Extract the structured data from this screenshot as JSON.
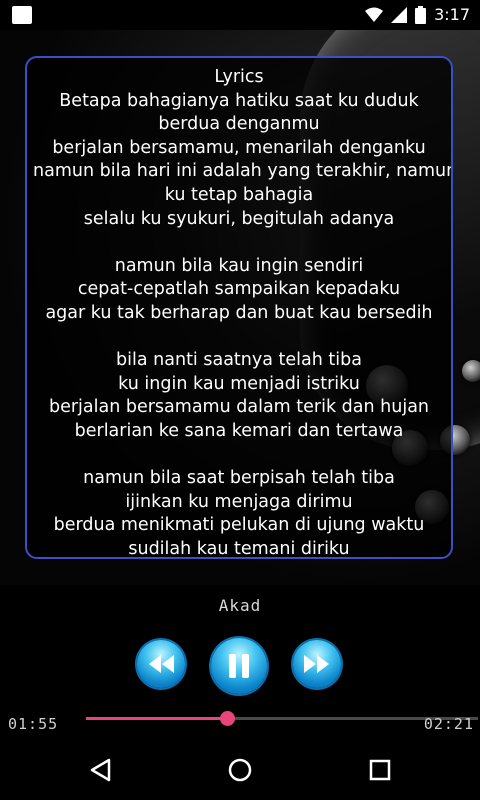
{
  "status_bar": {
    "time": "3:17"
  },
  "lyrics": {
    "heading": "Lyrics",
    "lines": [
      "Betapa bahagianya hatiku saat ku duduk",
      "berdua denganmu",
      "berjalan bersamamu, menarilah denganku",
      "namun bila hari ini adalah yang terakhir, namun",
      "ku tetap bahagia",
      "selalu ku syukuri, begitulah adanya",
      "",
      "namun bila kau ingin sendiri",
      "cepat-cepatlah sampaikan kepadaku",
      "agar ku tak berharap dan buat kau bersedih",
      "",
      "bila nanti saatnya telah tiba",
      "ku ingin kau menjadi istriku",
      "berjalan bersamamu dalam terik dan hujan",
      "berlarian ke sana kemari dan tertawa",
      "",
      "namun bila saat berpisah telah tiba",
      "ijinkan ku menjaga dirimu",
      "berdua menikmati pelukan di ujung waktu",
      "sudilah kau temani diriku"
    ]
  },
  "player": {
    "song_title": "Akad",
    "elapsed": "01:55",
    "duration": "02:21",
    "progress": 0.36,
    "accent_color": "#e8467a",
    "controls": [
      "rewind-icon",
      "pause-icon",
      "fast-forward-icon"
    ]
  },
  "nav": {
    "icons": [
      "back-icon",
      "home-icon",
      "recents-icon"
    ]
  }
}
